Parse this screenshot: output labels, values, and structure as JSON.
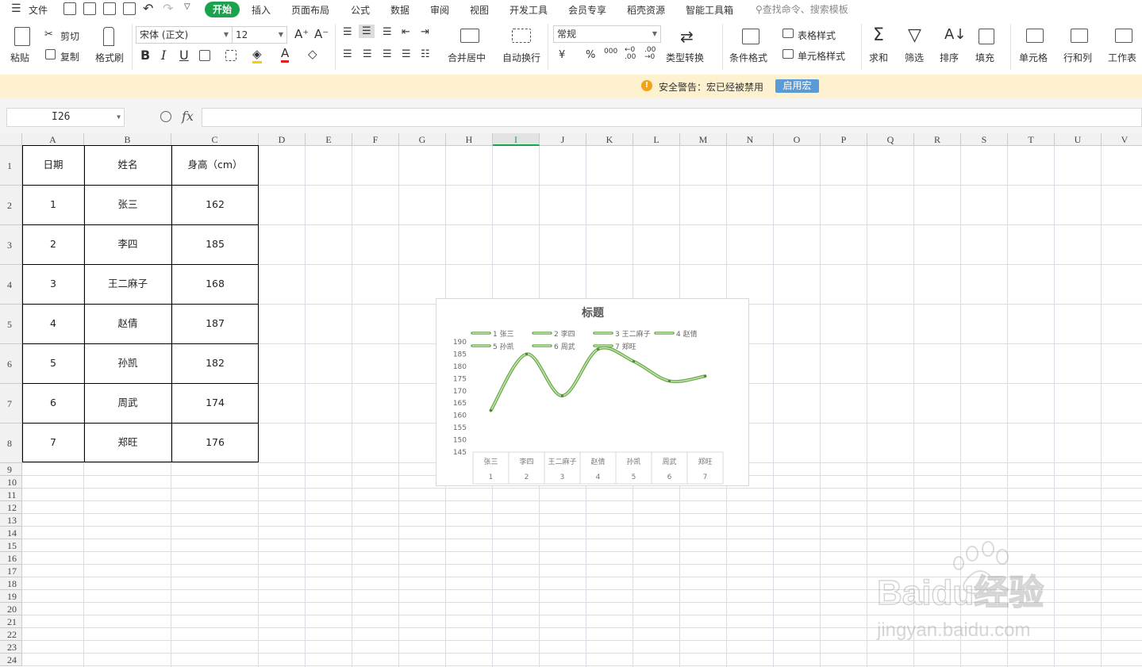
{
  "menubar": {
    "file_label": "文件",
    "tabs": [
      "开始",
      "插入",
      "页面布局",
      "公式",
      "数据",
      "审阅",
      "视图",
      "开发工具",
      "会员专享",
      "稻壳资源",
      "智能工具箱"
    ],
    "active_tab": "开始",
    "search_placeholder": "查找命令、搜索模板"
  },
  "toolbar": {
    "paste": "粘贴",
    "cut": "剪切",
    "copy": "复制",
    "format_painter": "格式刷",
    "font_name": "宋体 (正文)",
    "font_size": "12",
    "merge_center": "合并居中",
    "wrap_text": "自动换行",
    "number_format": "常规",
    "currency": "¥",
    "percent": "%",
    "thousands": "000",
    "type_convert": "类型转换",
    "conditional_format": "条件格式",
    "table_style": "表格样式",
    "cell_style": "单元格样式",
    "sum": "求和",
    "filter": "筛选",
    "sort": "排序",
    "fill": "填充",
    "cells": "单元格",
    "rows_cols": "行和列",
    "worksheet": "工作表"
  },
  "warning": {
    "text": "安全警告：宏已经被禁用",
    "button": "启用宏"
  },
  "formula_bar": {
    "cell_ref": "I26",
    "fx": "fx",
    "formula": ""
  },
  "columns": [
    "A",
    "B",
    "C",
    "D",
    "E",
    "F",
    "G",
    "H",
    "I",
    "J",
    "K",
    "L",
    "M",
    "N",
    "O",
    "P",
    "Q",
    "R",
    "S",
    "T",
    "U",
    "V"
  ],
  "selected_column": "I",
  "rows": [
    "1",
    "2",
    "3",
    "4",
    "5",
    "6",
    "7",
    "8",
    "9",
    "10",
    "11",
    "12",
    "13",
    "14",
    "15",
    "16",
    "17",
    "18",
    "19",
    "20",
    "21",
    "22",
    "23",
    "24"
  ],
  "table": {
    "headers": [
      "日期",
      "姓名",
      "身高（cm）"
    ],
    "rows": [
      [
        "1",
        "张三",
        "162"
      ],
      [
        "2",
        "李四",
        "185"
      ],
      [
        "3",
        "王二麻子",
        "168"
      ],
      [
        "4",
        "赵倩",
        "187"
      ],
      [
        "5",
        "孙凯",
        "182"
      ],
      [
        "6",
        "周武",
        "174"
      ],
      [
        "7",
        "郑旺",
        "176"
      ]
    ]
  },
  "chart_data": {
    "type": "line",
    "title": "标题",
    "categories": [
      "张三",
      "李四",
      "王二麻子",
      "赵倩",
      "孙凯",
      "周武",
      "郑旺"
    ],
    "category_indices": [
      "1",
      "2",
      "3",
      "4",
      "5",
      "6",
      "7"
    ],
    "legend": [
      "1 张三",
      "2 李四",
      "3 王二麻子",
      "4 赵倩",
      "5 孙凯",
      "6 周武",
      "7 郑旺"
    ],
    "values": [
      162,
      185,
      168,
      187,
      182,
      174,
      176
    ],
    "ylim": [
      145,
      190
    ],
    "yticks": [
      190,
      185,
      180,
      175,
      170,
      165,
      160,
      155,
      150,
      145
    ],
    "smooth": true,
    "line_color": "#6fae4e",
    "legend_position": "top"
  },
  "watermark": {
    "brand": "Baidu经验",
    "url": "jingyan.baidu.com"
  }
}
